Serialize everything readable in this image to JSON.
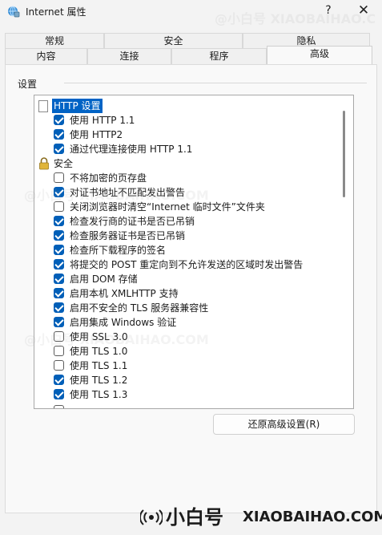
{
  "window": {
    "title": "Internet 属性",
    "help": "?",
    "close": "✕"
  },
  "tabs": {
    "row1": [
      "常规",
      "安全",
      "隐私"
    ],
    "row2": [
      "内容",
      "连接",
      "程序",
      "高级"
    ],
    "selected": "高级"
  },
  "settings": {
    "group_label": "设置",
    "items": [
      {
        "type": "header",
        "icon": "page-icon",
        "label": "HTTP 设置",
        "focused": true
      },
      {
        "type": "check",
        "checked": true,
        "label": "使用 HTTP 1.1"
      },
      {
        "type": "check",
        "checked": true,
        "label": "使用 HTTP2"
      },
      {
        "type": "check",
        "checked": true,
        "label": "通过代理连接使用 HTTP 1.1"
      },
      {
        "type": "header",
        "icon": "lock-icon",
        "label": "安全",
        "focused": false
      },
      {
        "type": "check",
        "checked": false,
        "label": "不将加密的页存盘"
      },
      {
        "type": "check",
        "checked": true,
        "label": "对证书地址不匹配发出警告"
      },
      {
        "type": "check",
        "checked": false,
        "label": "关闭浏览器时清空“Internet 临时文件”文件夹"
      },
      {
        "type": "check",
        "checked": true,
        "label": "检查发行商的证书是否已吊销"
      },
      {
        "type": "check",
        "checked": true,
        "label": "检查服务器证书是否已吊销"
      },
      {
        "type": "check",
        "checked": true,
        "label": "检查所下载程序的签名"
      },
      {
        "type": "check",
        "checked": true,
        "label": "将提交的 POST 重定向到不允许发送的区域时发出警告"
      },
      {
        "type": "check",
        "checked": true,
        "label": "启用 DOM 存储"
      },
      {
        "type": "check",
        "checked": true,
        "label": "启用本机 XMLHTTP 支持"
      },
      {
        "type": "check",
        "checked": true,
        "label": "启用不安全的 TLS 服务器兼容性"
      },
      {
        "type": "check",
        "checked": true,
        "label": "启用集成 Windows 验证"
      },
      {
        "type": "check",
        "checked": false,
        "label": "使用 SSL 3.0"
      },
      {
        "type": "check",
        "checked": false,
        "label": "使用 TLS 1.0"
      },
      {
        "type": "check",
        "checked": false,
        "label": "使用 TLS 1.1"
      },
      {
        "type": "check",
        "checked": true,
        "label": "使用 TLS 1.2"
      },
      {
        "type": "check",
        "checked": true,
        "label": "使用 TLS 1.3"
      }
    ],
    "reset_label": "还原高级设置(R)"
  },
  "watermark": {
    "repeat_text": "@小白号 XIAOBAIHAO.COM",
    "brand_cn": "小白号",
    "brand_en": "XIAOBAIHAO.COM"
  },
  "colors": {
    "accent": "#005fb8",
    "focus_highlight": "#0063c5",
    "background": "#f3f3f3"
  }
}
